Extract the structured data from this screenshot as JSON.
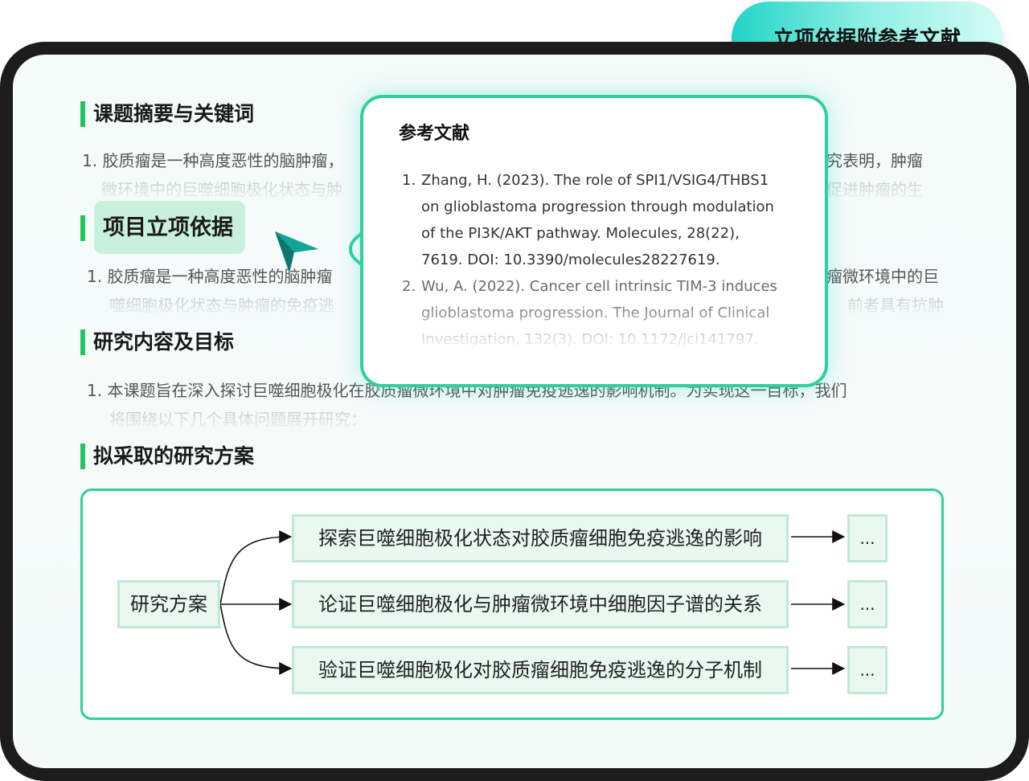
{
  "badge": {
    "text": "立项依据附参考文献"
  },
  "sections": [
    {
      "title": "课题摘要与关键词",
      "line1_visible": "1. 胶质瘤是一种高度恶性的脑肿瘤，",
      "line1_right": "究表明，肿瘤",
      "line2": "微环境中的巨噬细胞极化状态与肿",
      "line2_right": "促进肿瘤的生"
    },
    {
      "title": "项目立项依据",
      "line1_visible": "1. 胶质瘤是一种高度恶性的脑肿瘤",
      "line1_right": "瘤微环境中的巨",
      "line2": "噬细胞极化状态与肿瘤的免疫逃",
      "line2_right": "前者具有抗肿"
    },
    {
      "title": "研究内容及目标",
      "line1_visible": "1. 本课题旨在深入探讨巨噬细胞极化在胶质瘤微环境中对肿瘤免疫逃逸的影响机制。为实现这一目标，我们",
      "line2": "将围绕以下几个具体问题展开研究："
    },
    {
      "title": "拟采取的研究方案"
    }
  ],
  "popup": {
    "title": "参考文献",
    "references": [
      {
        "num": "1.",
        "lines": [
          "Zhang, H. (2023). The role of SPI1/VSIG4/THBS1",
          "on glioblastoma progression through modulation",
          "of the PI3K/AKT pathway. Molecules, 28(22),",
          "7619. DOI: 10.3390/molecules28227619."
        ]
      },
      {
        "num": "2.",
        "lines": [
          "Wu, A. (2022). Cancer cell intrinsic TIM-3 induces",
          "glioblastoma progression. The Journal of Clinical",
          "Investigation, 132(3). DOI: 10.1172/jci141797."
        ]
      }
    ]
  },
  "plan": {
    "root": "研究方案",
    "branches": [
      {
        "label": "探索巨噬细胞极化状态对胶质瘤细胞免疫逃逸的影响",
        "next": "..."
      },
      {
        "label": "论证巨噬细胞极化与肿瘤微环境中细胞因子谱的关系",
        "next": "..."
      },
      {
        "label": "验证巨噬细胞极化对胶质瘤细胞免疫逃逸的分子机制",
        "next": "..."
      }
    ]
  },
  "colors": {
    "accent": "#22c55e",
    "teal": "#22d3c8",
    "frame": "#1c1c1c"
  }
}
